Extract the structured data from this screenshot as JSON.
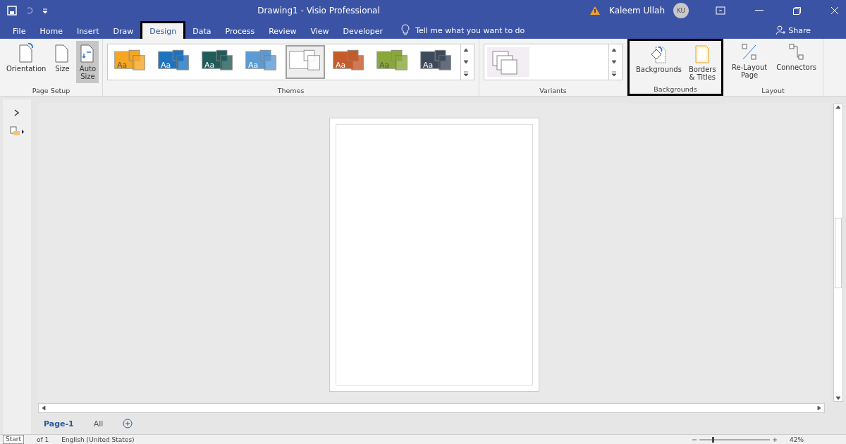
{
  "window": {
    "title": "Drawing1  -  Visio Professional",
    "user": "Kaleem Ullah",
    "initials": "KU"
  },
  "tabs": [
    {
      "label": "File",
      "selected": false
    },
    {
      "label": "Home",
      "selected": false
    },
    {
      "label": "Insert",
      "selected": false
    },
    {
      "label": "Draw",
      "selected": false
    },
    {
      "label": "Design",
      "selected": true
    },
    {
      "label": "Data",
      "selected": false
    },
    {
      "label": "Process",
      "selected": false
    },
    {
      "label": "Review",
      "selected": false
    },
    {
      "label": "View",
      "selected": false
    },
    {
      "label": "Developer",
      "selected": false
    }
  ],
  "tell_me": "Tell me what you want to do",
  "share": "Share",
  "page_setup": {
    "label": "Page Setup",
    "buttons": [
      {
        "label": "Orientation",
        "selected": false
      },
      {
        "label": "Size",
        "selected": false
      },
      {
        "label": "Auto Size",
        "selected": true
      }
    ]
  },
  "themes": {
    "label": "Themes",
    "items": [
      {
        "label": "Aa",
        "color": "#f5a623",
        "selected": false
      },
      {
        "label": "Aa",
        "color": "#1e73be",
        "selected": false
      },
      {
        "label": "Aa",
        "color": "#1f5c5a",
        "selected": false
      },
      {
        "label": "Aa",
        "color": "#5b9bd5",
        "selected": false
      },
      {
        "color": "#ffffff",
        "selected": true
      },
      {
        "label": "Aa",
        "color": "#c55a2b",
        "selected": false
      },
      {
        "label": "Aa",
        "color": "#8aa83a",
        "selected": false
      },
      {
        "label": "Aa",
        "color": "#3e4a5c",
        "selected": false
      }
    ]
  },
  "variants": {
    "label": "Variants"
  },
  "backgrounds": {
    "label": "Backgrounds",
    "buttons": [
      "Backgrounds",
      "Borders & Titles"
    ]
  },
  "layout": {
    "label": "Layout",
    "buttons": [
      "Re-Layout Page",
      "Connectors"
    ]
  },
  "pages": [
    {
      "label": "Page-1",
      "selected": true
    }
  ],
  "all": "All",
  "status": {
    "page": "Start",
    "of": "of 1",
    "language": "English (United States)",
    "zoom": "42%"
  }
}
